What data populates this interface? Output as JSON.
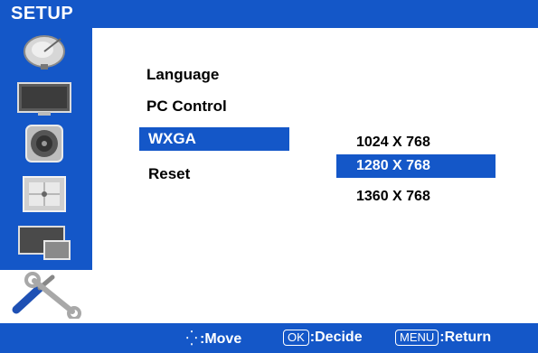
{
  "window": {
    "title": "SETUP"
  },
  "sidebar": {
    "items": [
      {
        "icon": "satellite-dish-icon"
      },
      {
        "icon": "picture-icon"
      },
      {
        "icon": "speaker-icon"
      },
      {
        "icon": "timer-icon"
      },
      {
        "icon": "pip-icon"
      }
    ],
    "active_icon": "setup-tools-icon"
  },
  "menu": {
    "items": [
      {
        "label": "Language"
      },
      {
        "label": "PC Control"
      },
      {
        "label": "WXGA"
      },
      {
        "label": "Reset"
      }
    ],
    "selected": "WXGA"
  },
  "submenu": {
    "options": [
      {
        "label": "1024 X 768"
      },
      {
        "label": "1280 X 768"
      },
      {
        "label": "1360 X 768"
      }
    ],
    "selected": "1280 X 768"
  },
  "footer": {
    "move_label": ":Move",
    "ok_key": "OK",
    "decide_label": ":Decide",
    "menu_key": "MENU",
    "return_label": ":Return"
  },
  "colors": {
    "accent": "#1457c8",
    "text": "#000000",
    "highlight_text": "#ffffff"
  }
}
